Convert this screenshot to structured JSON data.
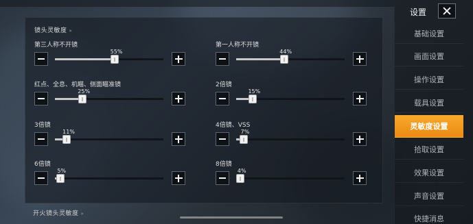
{
  "panel": {
    "section_title": "镜头灵敏度",
    "next_section_title": "开火镜头灵敏度",
    "sliders": [
      {
        "label": "第三人称不开镜",
        "value": 55,
        "display": "55%"
      },
      {
        "label": "第一人称不开镜",
        "value": 44,
        "display": "44%"
      },
      {
        "label": "红点、全息、机瞄、侧面瞄准镜",
        "value": 25,
        "display": "25%"
      },
      {
        "label": "2倍镜",
        "value": 15,
        "display": "15%"
      },
      {
        "label": "3倍镜",
        "value": 11,
        "display": "11%"
      },
      {
        "label": "4倍镜、VSS",
        "value": 7,
        "display": "7%"
      },
      {
        "label": "6倍镜",
        "value": 5,
        "display": "5%"
      },
      {
        "label": "8倍镜",
        "value": 4,
        "display": "4%"
      }
    ]
  },
  "nav": {
    "title": "设置",
    "items": [
      {
        "label": "基础设置",
        "active": false
      },
      {
        "label": "画面设置",
        "active": false
      },
      {
        "label": "操作设置",
        "active": false
      },
      {
        "label": "载具设置",
        "active": false
      },
      {
        "label": "灵敏度设置",
        "active": true
      },
      {
        "label": "拾取设置",
        "active": false
      },
      {
        "label": "效果设置",
        "active": false
      },
      {
        "label": "声音设置",
        "active": false
      },
      {
        "label": "快捷消息",
        "active": false
      }
    ]
  },
  "icons": {
    "close": "close-icon",
    "minus": "minus-icon",
    "plus": "plus-icon"
  },
  "colors": {
    "accent": "#f39a1e",
    "button_bg": "#0e1116"
  }
}
